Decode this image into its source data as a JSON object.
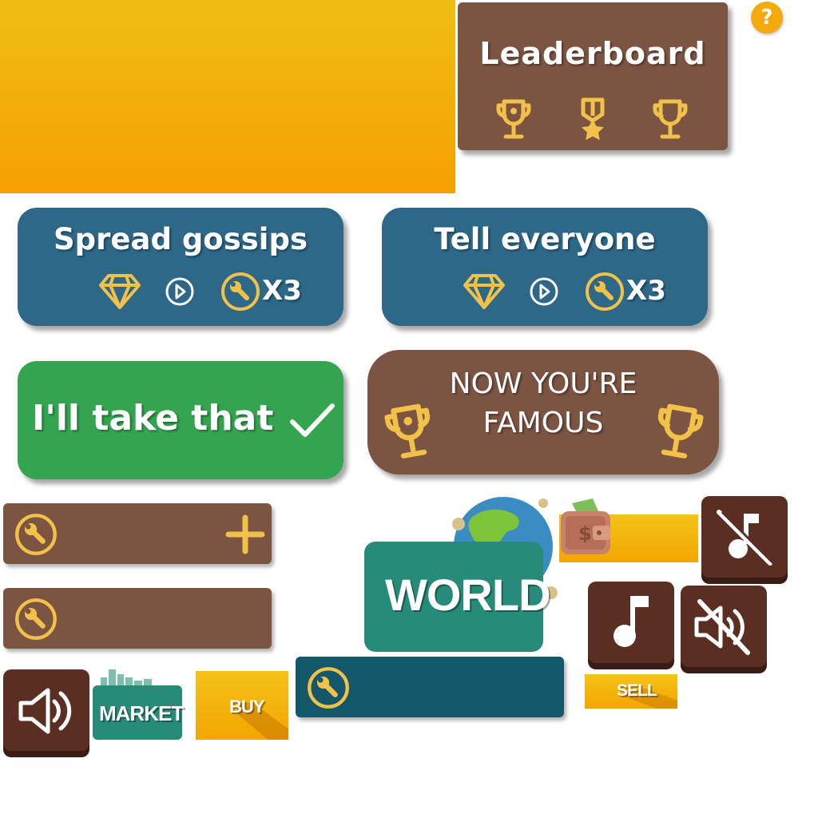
{
  "help_button": {
    "label": "?"
  },
  "leaderboard": {
    "title": "Leaderboard"
  },
  "actions": [
    {
      "title": "Spread gossips",
      "multiplier": "X3"
    },
    {
      "title": "Tell everyone",
      "multiplier": "X3"
    }
  ],
  "accept_button": {
    "label": "I'll take that"
  },
  "famous_banner": {
    "line1": "NOW YOU'RE",
    "line2": "FAMOUS"
  },
  "tags": {
    "world": "WORLD",
    "market": "MARKET",
    "buy": "BUY",
    "sell": "SELL"
  },
  "icons": [
    "question-icon",
    "trophy-icon",
    "medal-icon",
    "diamond-icon",
    "play-icon",
    "wrench-icon",
    "checkmark-icon",
    "plus-icon",
    "globe-icon",
    "wallet-icon",
    "music-off-icon",
    "music-icon",
    "mute-icon",
    "speaker-icon",
    "city-icon"
  ],
  "colors": {
    "gold": "#f2c14a",
    "brown": "#7c5442",
    "blue": "#2d6888",
    "green": "#35a451",
    "teal": "#268b78",
    "dark_teal": "#14566a",
    "orange": "#f5a90a",
    "dark_brown": "#5a2e22"
  }
}
